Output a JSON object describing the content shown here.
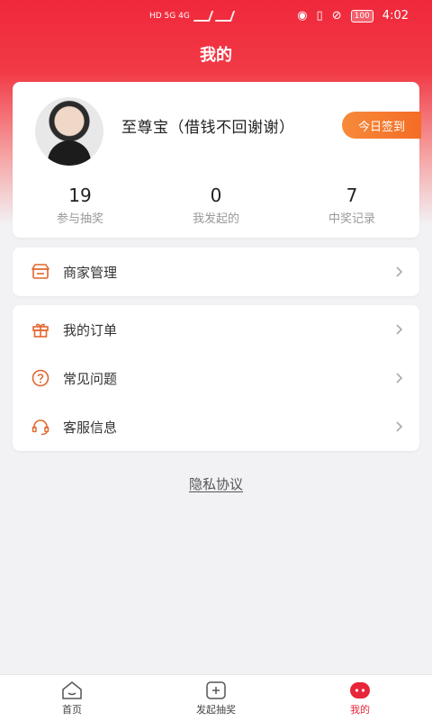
{
  "status_bar": {
    "network": "HD 5G 4G",
    "battery": "100",
    "time": "4:02"
  },
  "page_title": "我的",
  "profile": {
    "name": "至尊宝（借钱不回谢谢）",
    "sign_in_label": "今日签到"
  },
  "stats": [
    {
      "value": "19",
      "label": "参与抽奖"
    },
    {
      "value": "0",
      "label": "我发起的"
    },
    {
      "value": "7",
      "label": "中奖记录"
    }
  ],
  "menu_group_1": [
    {
      "label": "商家管理",
      "icon": "store-icon"
    }
  ],
  "menu_group_2": [
    {
      "label": "我的订单",
      "icon": "gift-icon"
    },
    {
      "label": "常见问题",
      "icon": "question-icon"
    },
    {
      "label": "客服信息",
      "icon": "headset-icon"
    }
  ],
  "privacy_label": "隐私协议",
  "bottom_nav": [
    {
      "label": "首页",
      "icon": "home-icon"
    },
    {
      "label": "发起抽奖",
      "icon": "add-lottery-icon"
    },
    {
      "label": "我的",
      "icon": "profile-icon",
      "active": true
    }
  ],
  "colors": {
    "primary": "#f0283c",
    "accent": "#f46c25",
    "icon_orange": "#e2662e"
  }
}
